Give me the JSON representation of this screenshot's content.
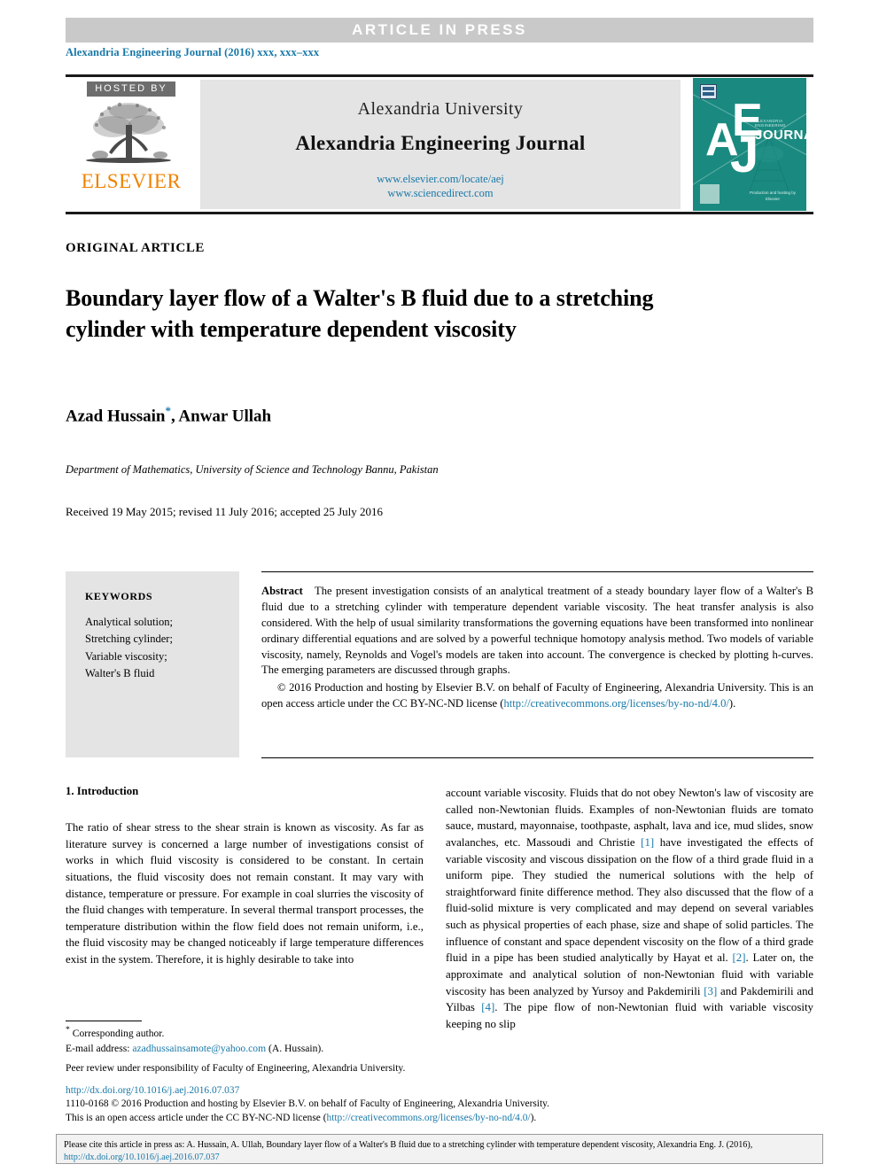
{
  "banner": {
    "text": "ARTICLE  IN  PRESS"
  },
  "citation_line": "Alexandria Engineering Journal (2016) xxx, xxx–xxx",
  "masthead": {
    "hosted_by": "HOSTED BY",
    "publisher": "ELSEVIER",
    "university": "Alexandria University",
    "journal_title": "Alexandria Engineering Journal",
    "url_locate": "www.elsevier.com/locate/aej",
    "url_sciencedirect": "www.sciencedirect.com",
    "cover": {
      "letter_a": "A",
      "letter_e": "E",
      "letter_j": "J",
      "journal_word": "JOURNAL",
      "cover_subtitle": "ALEXANDRIA ENGINEERING",
      "cover_footer": "Production and hosting by Elsevier"
    }
  },
  "article": {
    "type_label": "ORIGINAL ARTICLE",
    "title": "Boundary layer flow of a Walter's B fluid due to a stretching cylinder with temperature dependent viscosity",
    "authors": "Azad Hussain",
    "authors_rest": ", Anwar Ullah",
    "corresponding_marker": "*",
    "affiliation": "Department of Mathematics, University of Science and Technology Bannu, Pakistan",
    "dates": "Received 19 May 2015; revised 11 July 2016; accepted 25 July 2016"
  },
  "keywords": {
    "heading": "KEYWORDS",
    "items": [
      "Analytical solution;",
      "Stretching cylinder;",
      "Variable viscosity;",
      "Walter's B fluid"
    ]
  },
  "abstract": {
    "label": "Abstract",
    "text": "The present investigation consists of an analytical treatment of a steady boundary layer flow of a Walter's B fluid due to a stretching cylinder with temperature dependent variable viscosity. The heat transfer analysis is also considered. With the help of usual similarity transformations the governing equations have been transformed into nonlinear ordinary differential equations and are solved by a powerful technique homotopy analysis method. Two models of variable viscosity, namely, Reynolds and Vogel's models are taken into account. The convergence is checked by plotting h-curves. The emerging parameters are discussed through graphs.",
    "copyright_pre": "© 2016 Production and hosting by Elsevier B.V. on behalf of Faculty of Engineering, Alexandria University. This is an open access article under the CC BY-NC-ND license (",
    "copyright_link": "http://creativecommons.org/licenses/by-no-nd/4.0/",
    "copyright_post": ")."
  },
  "body": {
    "section_heading": "1. Introduction",
    "left_column": "The ratio of shear stress to the shear strain is known as viscosity. As far as literature survey is concerned a large number of investigations consist of works in which fluid viscosity is considered to be constant. In certain situations, the fluid viscosity does not remain constant. It may vary with distance, temperature or pressure. For example in coal slurries the viscosity of the fluid changes with temperature. In several thermal transport processes, the temperature distribution within the flow field does not remain uniform, i.e., the fluid viscosity may be changed noticeably if large temperature differences exist in the system. Therefore, it is highly desirable to take into",
    "right_column_1": "account variable viscosity. Fluids that do not obey Newton's law of viscosity are called non-Newtonian fluids. Examples of non-Newtonian fluids are tomato sauce, mustard, mayonnaise, toothpaste, asphalt, lava and ice, mud slides, snow avalanches, etc. Massoudi and Christie ",
    "ref_1": "[1]",
    "right_column_2": " have investigated the effects of variable viscosity and viscous dissipation on the flow of a third grade fluid in a uniform pipe. They studied the numerical solutions with the help of straightforward finite difference method. They also discussed that the flow of a fluid-solid mixture is very complicated and may depend on several variables such as physical properties of each phase, size and shape of solid particles. The influence of constant and space dependent viscosity on the flow of a third grade fluid in a pipe has been studied analytically by Hayat et al. ",
    "ref_2": "[2]",
    "right_column_3": ". Later on, the approximate and analytical solution of non-Newtonian fluid with variable viscosity has been analyzed by Yursoy and Pakdemirili ",
    "ref_3": "[3]",
    "right_column_4": " and Pakdemirili and Yilbas ",
    "ref_4": "[4]",
    "right_column_5": ". The pipe flow of non-Newtonian fluid with variable viscosity keeping no slip"
  },
  "footnotes": {
    "corresponding": "Corresponding author.",
    "email_label": "E-mail address:",
    "email": "azadhussainsamote@yahoo.com",
    "email_suffix": "(A. Hussain).",
    "peer_review": "Peer review under responsibility of Faculty of Engineering, Alexandria University.",
    "doi": "http://dx.doi.org/10.1016/j.aej.2016.07.037",
    "issn_line": "1110-0168 © 2016 Production and hosting by Elsevier B.V. on behalf of Faculty of Engineering, Alexandria University.",
    "license_pre": "This is an open access article under the CC BY-NC-ND license (",
    "license_link": "http://creativecommons.org/licenses/by-no-nd/4.0/",
    "license_post": ")."
  },
  "cite_box": {
    "text_pre": "Please cite this article in press as: A. Hussain, A. Ullah, Boundary layer flow of a Walter's B fluid due to a stretching cylinder with temperature dependent viscosity, Alexandria Eng. J. (2016), ",
    "link": "http://dx.doi.org/10.1016/j.aej.2016.07.037"
  },
  "colors": {
    "link": "#1878a8",
    "banner_bg": "#c9c9c9",
    "cover_teal": "#1a8a80",
    "elsevier_orange": "#ef8200",
    "panel_gray": "#e4e4e4"
  }
}
